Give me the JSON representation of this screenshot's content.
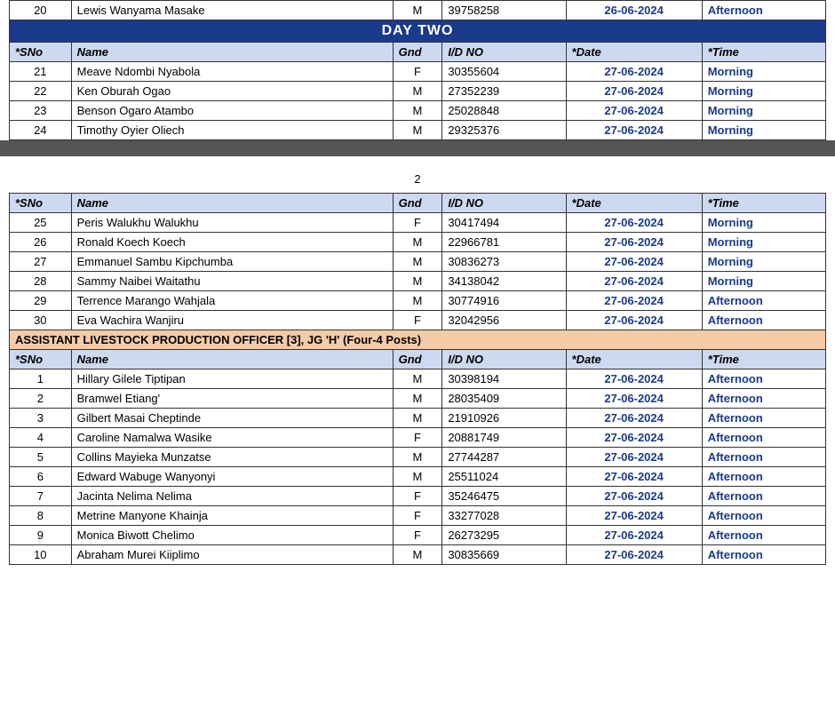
{
  "page": {
    "pageNumber": "2"
  },
  "dayTwo": {
    "header": "DAY TWO",
    "columnHeaders": [
      "*SNo",
      "Name",
      "Gnd",
      "I/D NO",
      "*Date",
      "*Time"
    ],
    "rows": [
      {
        "sno": "21",
        "name": "Meave Ndombi Nyabola",
        "gnd": "F",
        "idno": "30355604",
        "date": "27-06-2024",
        "time": "Morning"
      },
      {
        "sno": "22",
        "name": "Ken Oburah Ogao",
        "gnd": "M",
        "idno": "27352239",
        "date": "27-06-2024",
        "time": "Morning"
      },
      {
        "sno": "23",
        "name": "Benson Ogaro Atambo",
        "gnd": "M",
        "idno": "25028848",
        "date": "27-06-2024",
        "time": "Morning"
      },
      {
        "sno": "24",
        "name": "Timothy Oyier Oliech",
        "gnd": "M",
        "idno": "29325376",
        "date": "27-06-2024",
        "time": "Morning"
      }
    ]
  },
  "continuation": {
    "columnHeaders": [
      "*SNo",
      "Name",
      "Gnd",
      "I/D NO",
      "*Date",
      "*Time"
    ],
    "rows": [
      {
        "sno": "25",
        "name": "Peris Walukhu Walukhu",
        "gnd": "F",
        "idno": "30417494",
        "date": "27-06-2024",
        "time": "Morning"
      },
      {
        "sno": "26",
        "name": "Ronald Koech Koech",
        "gnd": "M",
        "idno": "22966781",
        "date": "27-06-2024",
        "time": "Morning"
      },
      {
        "sno": "27",
        "name": "Emmanuel  Sambu Kipchumba",
        "gnd": "M",
        "idno": "30836273",
        "date": "27-06-2024",
        "time": "Morning"
      },
      {
        "sno": "28",
        "name": "Sammy Naibei Waitathu",
        "gnd": "M",
        "idno": "34138042",
        "date": "27-06-2024",
        "time": "Morning"
      },
      {
        "sno": "29",
        "name": "Terrence  Marango Wahjala",
        "gnd": "M",
        "idno": "30774916",
        "date": "27-06-2024",
        "time": "Afternoon"
      },
      {
        "sno": "30",
        "name": "Eva Wachira Wanjiru",
        "gnd": "F",
        "idno": "32042956",
        "date": "27-06-2024",
        "time": "Afternoon"
      }
    ],
    "sectionHeader": "ASSISTANT LIVESTOCK PRODUCTION OFFICER [3], JG 'H' (Four-4 Posts)",
    "sectionRows": [
      {
        "sno": "1",
        "name": "Hillary  Gilele Tiptipan",
        "gnd": "M",
        "idno": "30398194",
        "date": "27-06-2024",
        "time": "Afternoon"
      },
      {
        "sno": "2",
        "name": "Bramwel Etiang'",
        "gnd": "M",
        "idno": "28035409",
        "date": "27-06-2024",
        "time": "Afternoon"
      },
      {
        "sno": "3",
        "name": "Gilbert Masai Cheptinde",
        "gnd": "M",
        "idno": "21910926",
        "date": "27-06-2024",
        "time": "Afternoon"
      },
      {
        "sno": "4",
        "name": "Caroline Namalwa Wasike",
        "gnd": "F",
        "idno": "20881749",
        "date": "27-06-2024",
        "time": "Afternoon"
      },
      {
        "sno": "5",
        "name": "Collins Mayieka Munzatse",
        "gnd": "M",
        "idno": "27744287",
        "date": "27-06-2024",
        "time": "Afternoon"
      },
      {
        "sno": "6",
        "name": "Edward Wabuge Wanyonyi",
        "gnd": "M",
        "idno": "25511024",
        "date": "27-06-2024",
        "time": "Afternoon"
      },
      {
        "sno": "7",
        "name": "Jacinta Nelima Nelima",
        "gnd": "F",
        "idno": "35246475",
        "date": "27-06-2024",
        "time": "Afternoon"
      },
      {
        "sno": "8",
        "name": "Metrine Manyone Khainja",
        "gnd": "F",
        "idno": "33277028",
        "date": "27-06-2024",
        "time": "Afternoon"
      },
      {
        "sno": "9",
        "name": "Monica Biwott Chelimo",
        "gnd": "F",
        "idno": "26273295",
        "date": "27-06-2024",
        "time": "Afternoon"
      },
      {
        "sno": "10",
        "name": "Abraham Murei Kiiplimo",
        "gnd": "M",
        "idno": "30835669",
        "date": "27-06-2024",
        "time": "Afternoon"
      }
    ]
  },
  "prevRow": {
    "sno": "20",
    "name": "Lewis Wanyama Masake",
    "gnd": "M",
    "idno": "39758258",
    "date": "26-06-2024",
    "time": "Afternoon"
  }
}
